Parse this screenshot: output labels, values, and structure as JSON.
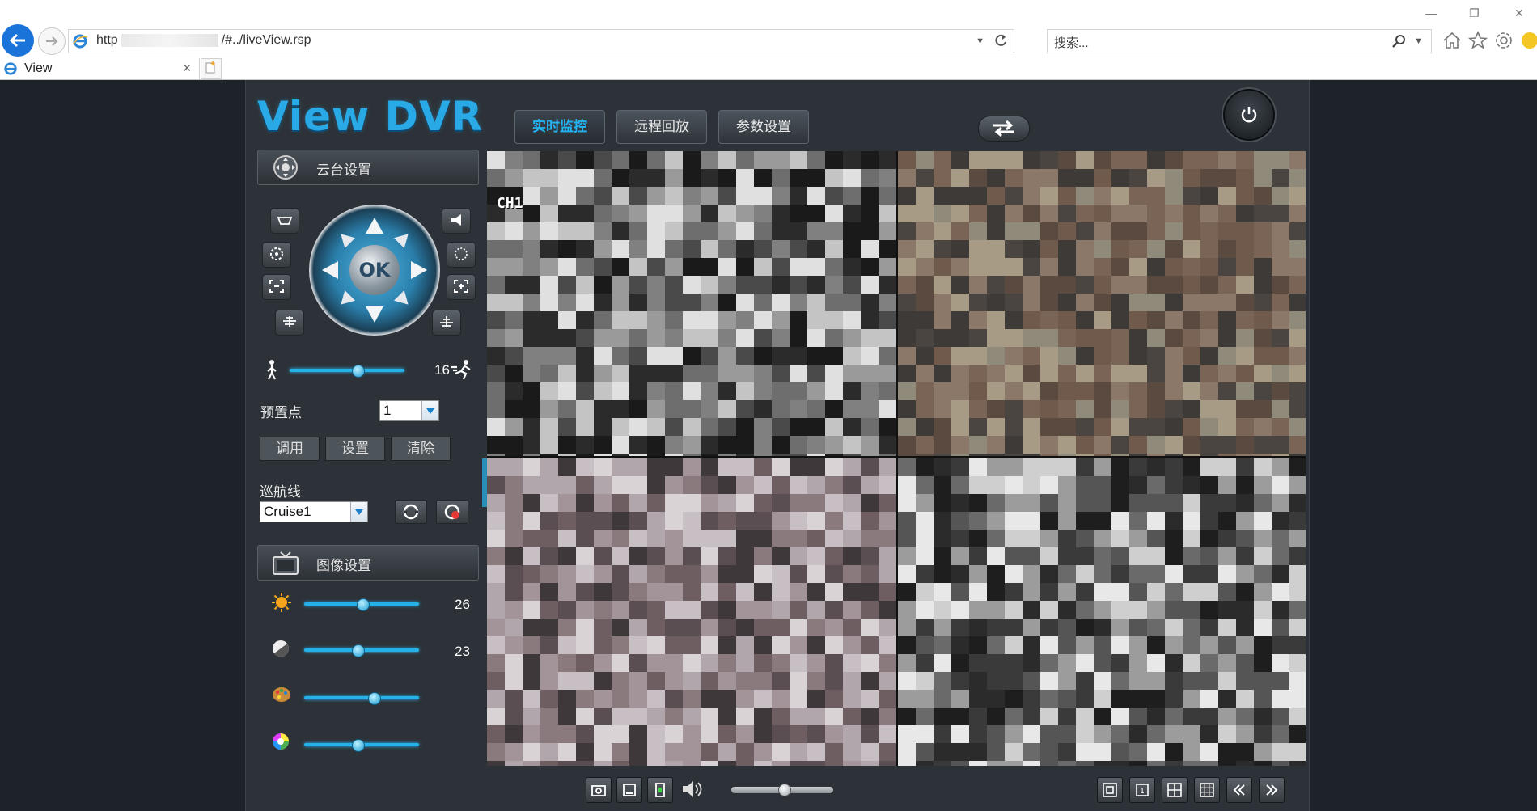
{
  "browser": {
    "url_prefix": "http",
    "url_suffix": "/#../liveView.rsp",
    "search_placeholder": "搜索...",
    "tab_title": "View"
  },
  "app": {
    "logo": "View DVR",
    "tabs": [
      {
        "label": "实时监控",
        "active": true
      },
      {
        "label": "远程回放",
        "active": false
      },
      {
        "label": "参数设置",
        "active": false
      }
    ],
    "accent_color": "#25b4f3"
  },
  "ptz": {
    "header": "云台设置",
    "ok_label": "OK",
    "speed_value": "16",
    "preset_label": "预置点",
    "preset_value": "1",
    "call_button": "调用",
    "set_button": "设置",
    "clear_button": "清除",
    "cruise_label": "巡航线",
    "cruise_value": "Cruise1"
  },
  "image_settings": {
    "header": "图像设置",
    "brightness": "26",
    "contrast": "23",
    "saturation_level": 0.5,
    "hue_level": 0.38
  },
  "video": {
    "selected_channel_label": "CH1"
  }
}
